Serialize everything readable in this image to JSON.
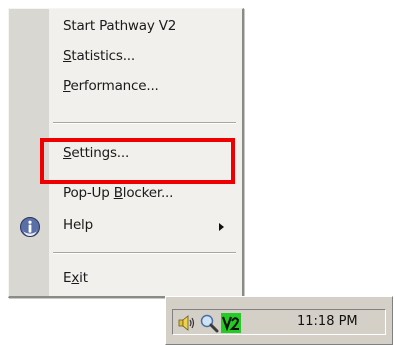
{
  "menu": {
    "items": [
      {
        "key": "start",
        "label": "Start Pathway V2"
      },
      {
        "key": "statistics",
        "pre": "",
        "accel": "S",
        "post": "tatistics..."
      },
      {
        "key": "performance",
        "pre": "",
        "accel": "P",
        "post": "erformance..."
      },
      {
        "key": "settings",
        "pre": "",
        "accel": "S",
        "post": "ettings..."
      },
      {
        "key": "popup",
        "pre": "Pop-Up ",
        "accel": "B",
        "post": "locker..."
      },
      {
        "key": "help",
        "label": "Help"
      },
      {
        "key": "exit",
        "pre": "E",
        "accel": "x",
        "post": "it"
      }
    ],
    "help_icon": "info-icon",
    "submenu_arrow": "submenu-arrow-icon"
  },
  "highlight": {
    "color": "#ee0000",
    "target": "settings"
  },
  "tray": {
    "icons": [
      "speaker-icon",
      "magnifier-icon",
      "pathway-v2-icon"
    ],
    "clock": "11:18 PM"
  },
  "colors": {
    "menu_bg": "#f1f0ec",
    "gutter_bg": "#d9d7d2",
    "taskbar_bg": "#d4d0c8",
    "v2_icon_bg": "#22cc22"
  }
}
